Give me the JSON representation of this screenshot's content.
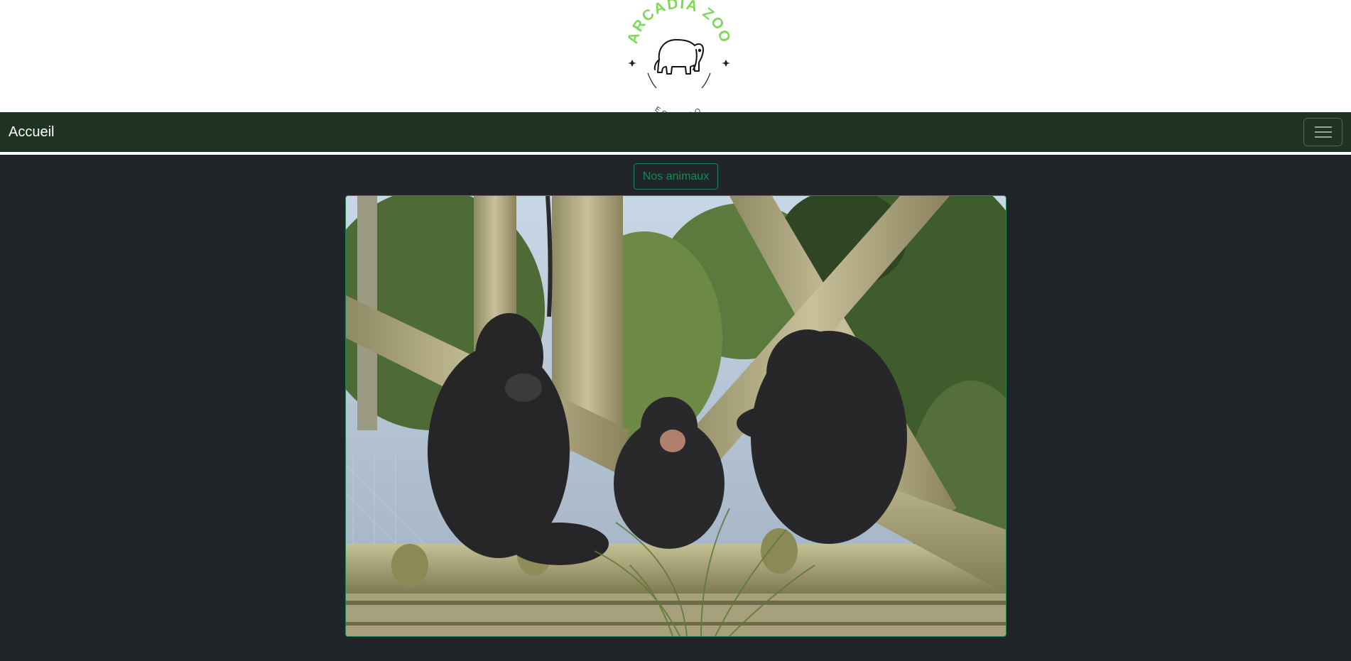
{
  "logo": {
    "title": "ARCADIA ZOO",
    "tagline": "ECO ZOO",
    "accent_color": "#7ed957",
    "icon": "elephant-icon"
  },
  "navbar": {
    "brand": "Accueil",
    "background": "#1e3322",
    "toggler_icon": "hamburger-menu-icon"
  },
  "main": {
    "cta_label": "Nos animaux",
    "cta_color": "#198754",
    "hero_image": "chimpanzees-photo"
  }
}
